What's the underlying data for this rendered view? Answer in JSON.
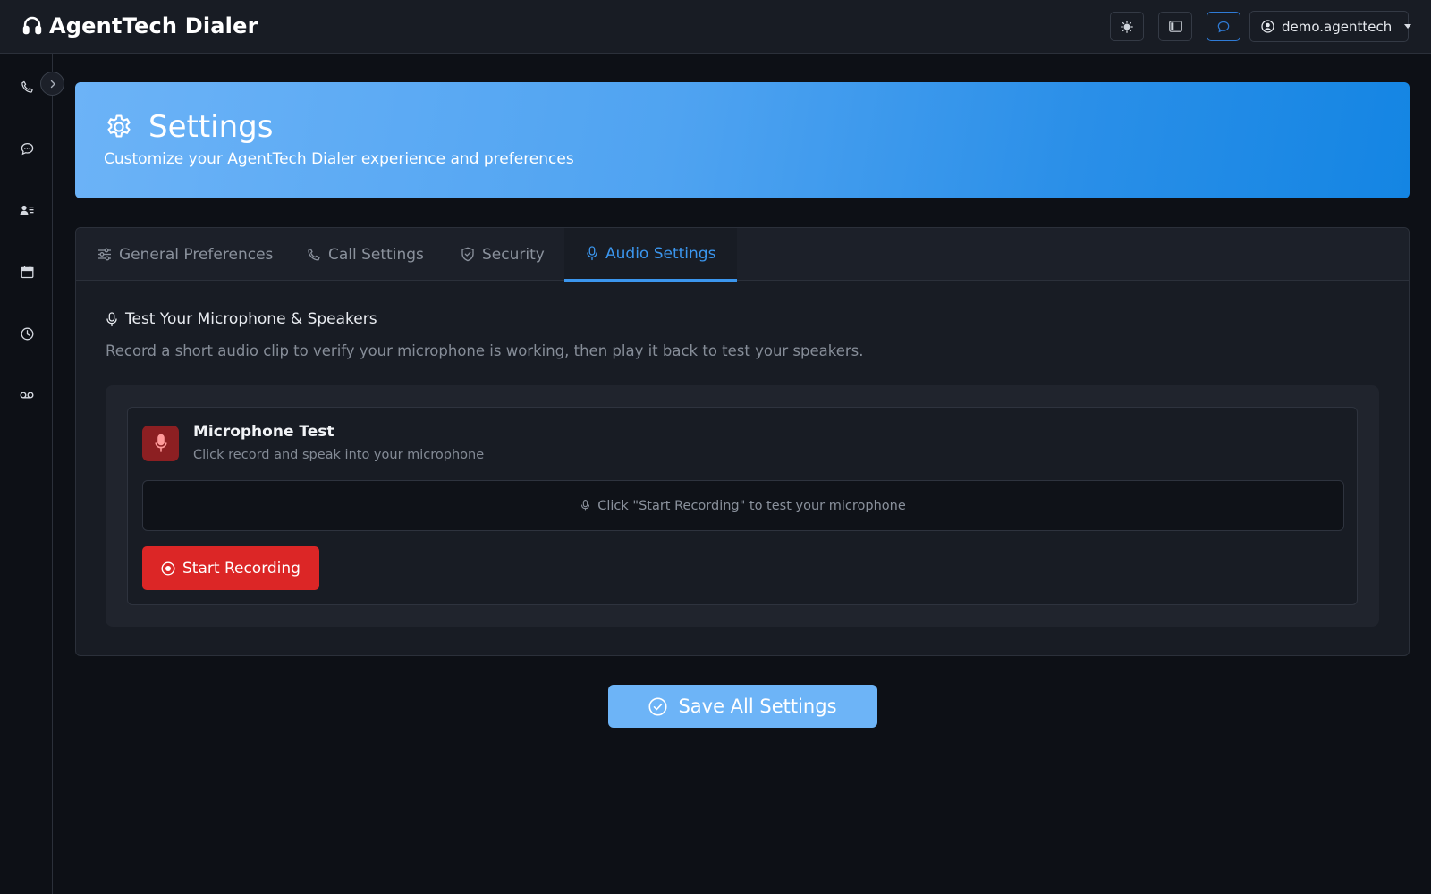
{
  "app": {
    "title": "AgentTech Dialer",
    "user": "demo.agenttech"
  },
  "topbar": {
    "buttons": [
      {
        "icon": "sun-icon",
        "state": "default"
      },
      {
        "icon": "sidebar-layout-icon",
        "state": "default"
      },
      {
        "icon": "chat-icon",
        "state": "active"
      }
    ]
  },
  "sidebar": {
    "items": [
      {
        "icon": "phone-icon"
      },
      {
        "icon": "chat-icon"
      },
      {
        "icon": "contacts-icon"
      },
      {
        "icon": "calendar-icon"
      },
      {
        "icon": "clock-icon"
      },
      {
        "icon": "voicemail-icon"
      }
    ]
  },
  "header": {
    "title": "Settings",
    "subtitle": "Customize your AgentTech Dialer experience and preferences"
  },
  "tabs": [
    {
      "label": "General Preferences",
      "icon": "sliders-icon",
      "active": false
    },
    {
      "label": "Call Settings",
      "icon": "phone-icon",
      "active": false
    },
    {
      "label": "Security",
      "icon": "shield-icon",
      "active": false
    },
    {
      "label": "Audio Settings",
      "icon": "microphone-icon",
      "active": true
    }
  ],
  "audio": {
    "section_title": "Test Your Microphone & Speakers",
    "section_desc": "Record a short audio clip to verify your microphone is working, then play it back to test your speakers.",
    "mic_test": {
      "title": "Microphone Test",
      "subtitle": "Click record and speak into your microphone",
      "placeholder": "Click \"Start Recording\" to test your microphone",
      "record_label": "Start Recording"
    }
  },
  "save_label": "Save All Settings",
  "colors": {
    "accent": "#3b96ee",
    "record": "#dc2626",
    "background": "#0d1016",
    "surface": "#181c24"
  }
}
